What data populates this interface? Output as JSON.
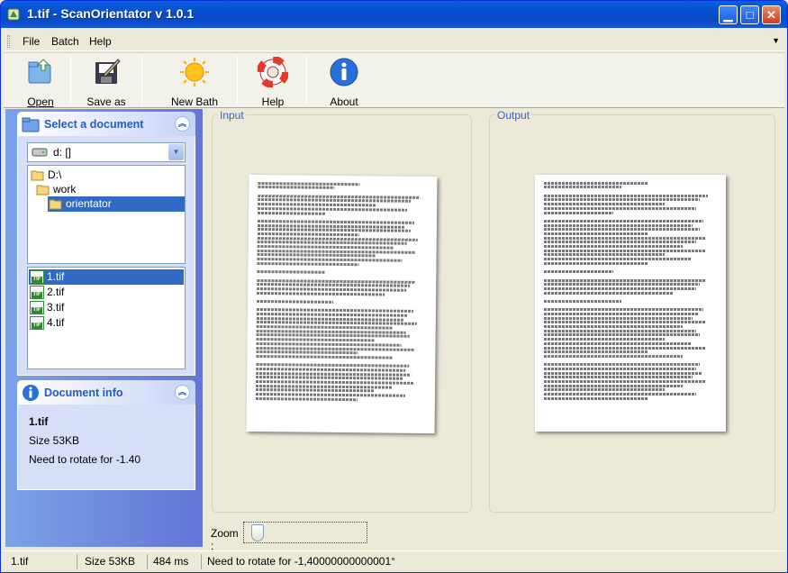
{
  "window": {
    "title": "1.tif - ScanOrientator v 1.0.1"
  },
  "menu": [
    "File",
    "Batch",
    "Help"
  ],
  "toolbar": [
    {
      "label": "Open",
      "icon": "open-folder-icon"
    },
    {
      "label": "Save as",
      "icon": "save-as-icon"
    },
    {
      "label": "New Bath",
      "icon": "new-batch-sun-icon"
    },
    {
      "label": "Help",
      "icon": "lifebuoy-help-icon"
    },
    {
      "label": "About",
      "icon": "info-icon"
    }
  ],
  "select_document": {
    "title": "Select a document",
    "drive": "d: []",
    "folders": [
      "D:\\",
      "work",
      "orientator"
    ],
    "files": [
      "1.tif",
      "2.tif",
      "3.tif",
      "4.tif"
    ]
  },
  "document_info": {
    "title": "Document info",
    "name": "1.tif",
    "size": "Size 53KB",
    "rotation": "Need to rotate for -1.40"
  },
  "panes": {
    "input_label": "Input",
    "output_label": "Output"
  },
  "zoom": {
    "label": "Zoom :",
    "level": 0.05
  },
  "status": {
    "file": "1.tif",
    "size": "Size 53KB",
    "time": "484 ms",
    "message": "Need to rotate for -1,40000000000001°"
  },
  "colors": {
    "titlebar": "#0a5fe0",
    "panel": "#7ba2e7",
    "selection": "#316ac5",
    "group_title": "#215dc6"
  }
}
